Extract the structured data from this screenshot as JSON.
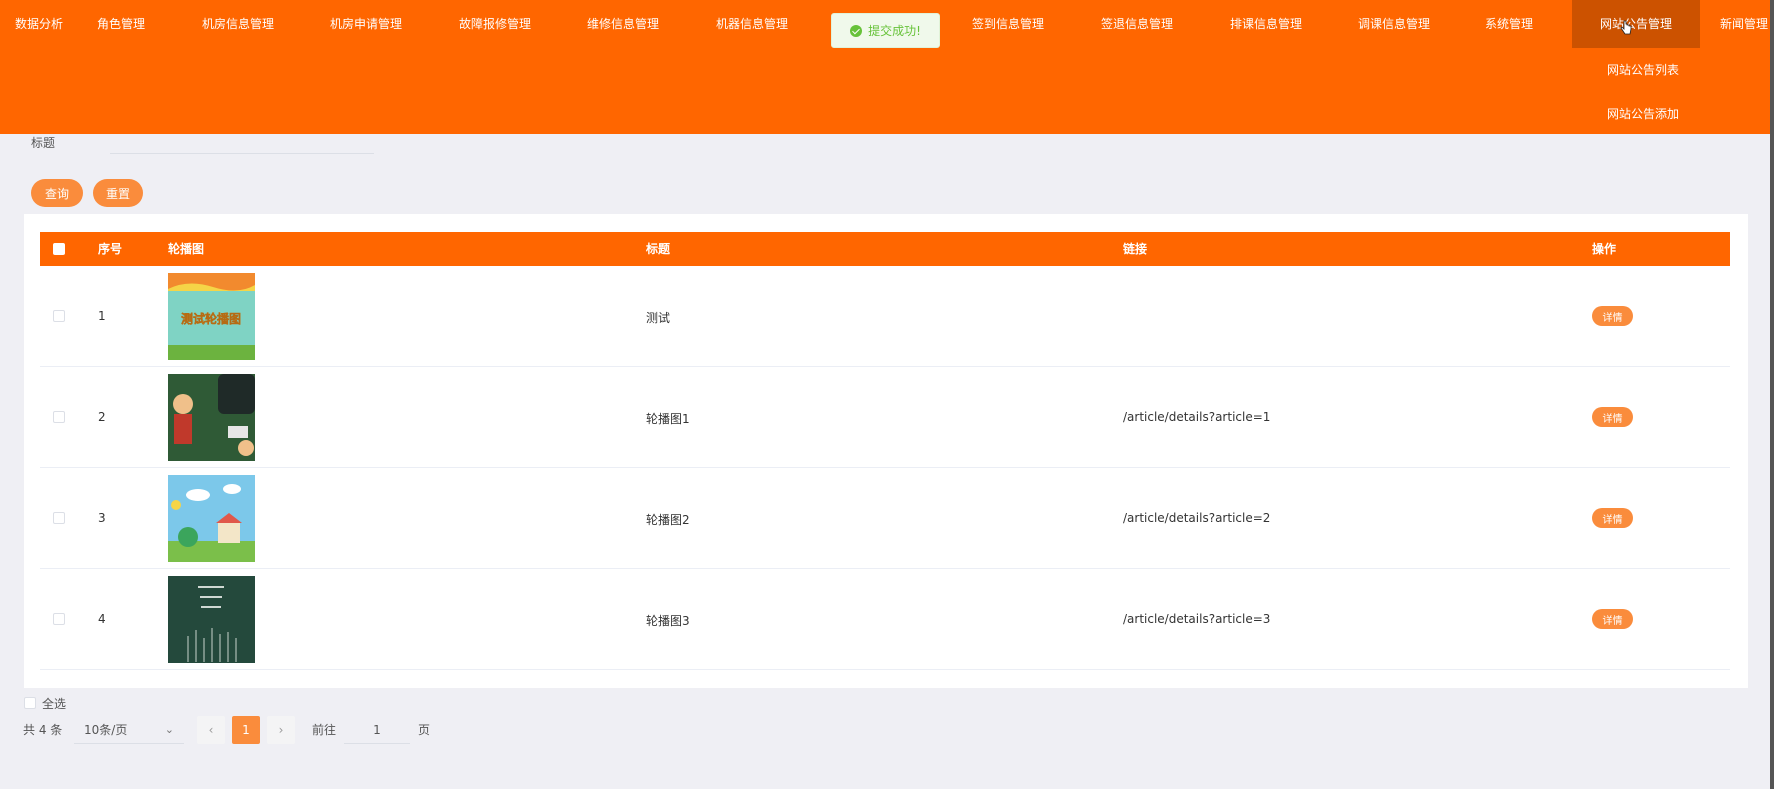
{
  "nav": {
    "items": [
      "数据分析",
      "角色管理",
      "机房信息管理",
      "机房申请管理",
      "故障报修管理",
      "维修信息管理",
      "机器信息管理",
      "签到信息管理",
      "签退信息管理",
      "排课信息管理",
      "调课信息管理",
      "系统管理",
      "网站公告管理",
      "新闻管理"
    ],
    "dropdown": [
      "网站公告列表",
      "网站公告添加"
    ]
  },
  "toast": {
    "text": "提交成功!"
  },
  "search": {
    "label": "标题",
    "value": "",
    "query_label": "查询",
    "reset_label": "重置"
  },
  "table": {
    "headers": {
      "index": "序号",
      "image": "轮播图",
      "title": "标题",
      "link": "链接",
      "action": "操作"
    },
    "rows": [
      {
        "index": "1",
        "title": "测试",
        "link": "",
        "action": "详情",
        "thumb_text": "测试轮播图"
      },
      {
        "index": "2",
        "title": "轮播图1",
        "link": "/article/details?article=1",
        "action": "详情"
      },
      {
        "index": "3",
        "title": "轮播图2",
        "link": "/article/details?article=2",
        "action": "详情"
      },
      {
        "index": "4",
        "title": "轮播图3",
        "link": "/article/details?article=3",
        "action": "详情"
      }
    ]
  },
  "footer": {
    "select_all": "全选",
    "total": "共 4 条",
    "page_size": "10条/页",
    "prev": "‹",
    "current_page": "1",
    "next": "›",
    "goto_label": "前往",
    "goto_value": "1",
    "goto_unit": "页"
  },
  "colors": {
    "primary": "#ff6600",
    "button": "#fa8c3c",
    "success": "#67c23a"
  }
}
